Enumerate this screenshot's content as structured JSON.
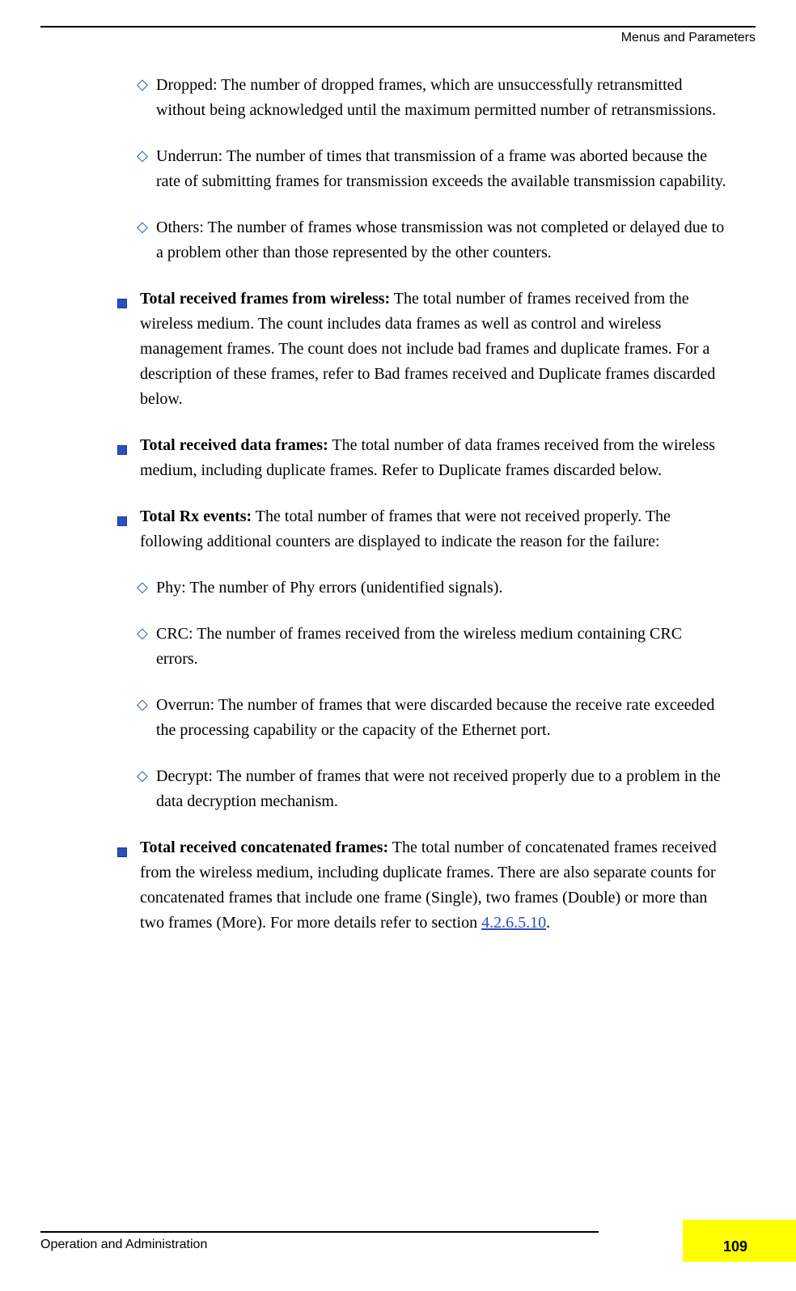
{
  "header": {
    "section_title": "Menus and Parameters"
  },
  "body": {
    "sub_items_top": [
      {
        "text": "Dropped:  The number of dropped frames, which are unsuccessfully retransmitted without being acknowledged until the maximum permitted number of retransmissions."
      },
      {
        "text": "Underrun: The number of times that transmission of a frame was aborted because the rate of submitting frames for transmission exceeds the available transmission capability."
      },
      {
        "text": "Others: The number of frames whose transmission was not completed or delayed due to a problem other than those represented by the other counters."
      }
    ],
    "main_items": [
      {
        "lead": "Total received frames from wireless:",
        "rest": " The total number of frames received from the wireless medium. The count includes data frames as well as control and wireless management frames. The count does not include bad frames and duplicate frames. For a description of these frames, refer to Bad frames received and Duplicate frames discarded below."
      },
      {
        "lead": "Total received data frames:",
        "rest": " The total number of data frames received from the wireless medium, including duplicate frames. Refer to Duplicate frames discarded below."
      },
      {
        "lead": "Total Rx events:",
        "rest": " The total number of frames that were not received properly. The following additional counters are displayed to indicate the reason for the failure:",
        "sub": [
          {
            "text": "Phy: The number of Phy errors (unidentified signals)."
          },
          {
            "text": "CRC: The number of frames received from the wireless medium containing CRC errors."
          },
          {
            "text": "Overrun: The number of frames that were discarded because the receive rate exceeded the processing capability or the capacity of the Ethernet port."
          },
          {
            "text": "Decrypt: The number of frames that were not received properly due to a problem in the data decryption mechanism."
          }
        ]
      },
      {
        "lead": "Total received concatenated frames:",
        "rest_pre": " The total number of concatenated frames received from the wireless medium, including duplicate frames. There are also separate counts for concatenated frames that include one frame (Single), two frames (Double) or more than two frames (More). For more details refer to section ",
        "link": "4.2.6.5.10",
        "rest_post": "."
      }
    ]
  },
  "footer": {
    "doc_title": "Operation and Administration",
    "page_number": "109"
  }
}
